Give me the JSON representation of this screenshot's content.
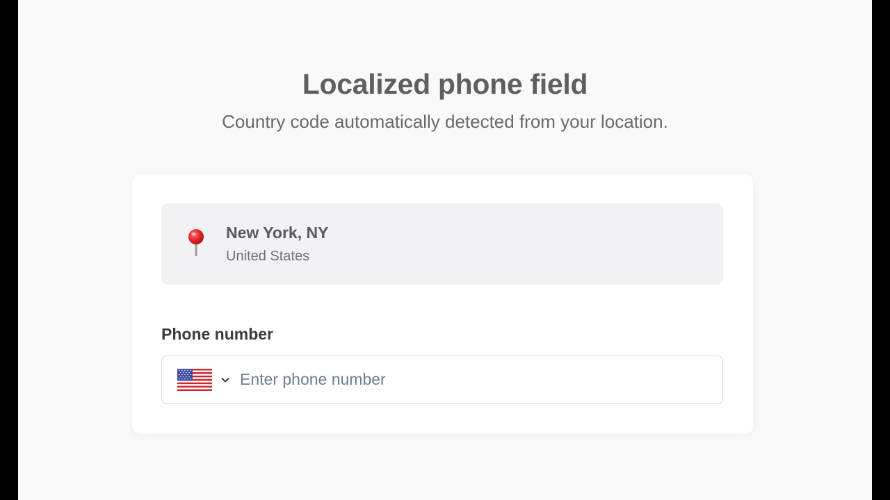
{
  "header": {
    "title": "Localized phone field",
    "subtitle": "Country code automatically detected from your location."
  },
  "location": {
    "icon": "map-pin-icon",
    "city": "New York, NY",
    "country": "United States"
  },
  "phone": {
    "label": "Phone number",
    "placeholder": "Enter phone number",
    "value": "",
    "country_flag": "us-flag-icon",
    "selector_icon": "chevron-down-icon"
  },
  "colors": {
    "background": "#f9f9fa",
    "card": "#ffffff",
    "location_box": "#f2f2f4",
    "pin_red": "#e0262a",
    "placeholder": "#6f7b93"
  }
}
